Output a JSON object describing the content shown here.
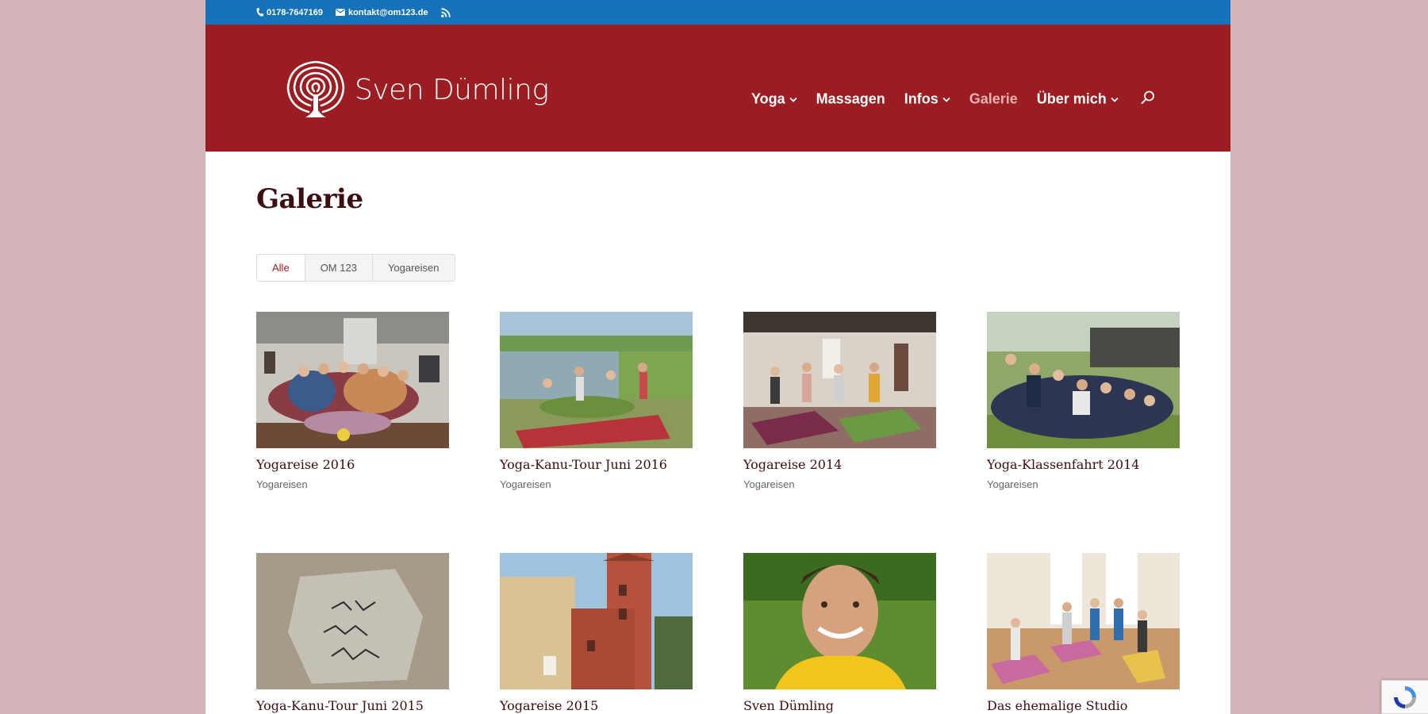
{
  "topbar": {
    "phone": "0178-7647169",
    "email": "kontakt@om123.de",
    "icons": [
      "phone-icon",
      "mail-icon",
      "rss-icon"
    ],
    "color": "#1673ba"
  },
  "header": {
    "logo_text": "Sven Dümling",
    "color": "#9b1d21",
    "nav": [
      {
        "label": "Yoga",
        "has_dropdown": true
      },
      {
        "label": "Massagen",
        "has_dropdown": false
      },
      {
        "label": "Infos",
        "has_dropdown": true
      },
      {
        "label": "Galerie",
        "has_dropdown": false,
        "active": true
      },
      {
        "label": "Über mich",
        "has_dropdown": true
      }
    ]
  },
  "main": {
    "title": "Galerie",
    "filters": [
      {
        "label": "Alle",
        "active": true
      },
      {
        "label": "OM 123"
      },
      {
        "label": "Yogareisen"
      }
    ],
    "gallery": [
      {
        "title": "Yogareise 2016",
        "category": "Yogareisen"
      },
      {
        "title": "Yoga-Kanu-Tour Juni 2016",
        "category": "Yogareisen"
      },
      {
        "title": "Yogareise 2014",
        "category": "Yogareisen"
      },
      {
        "title": "Yoga-Klassenfahrt 2014",
        "category": "Yogareisen"
      },
      {
        "title": "Yoga-Kanu-Tour Juni 2015",
        "category": ""
      },
      {
        "title": "Yogareise 2015",
        "category": ""
      },
      {
        "title": "Sven Dümling",
        "category": ""
      },
      {
        "title": "Das ehemalige Studio",
        "category": ""
      }
    ]
  }
}
